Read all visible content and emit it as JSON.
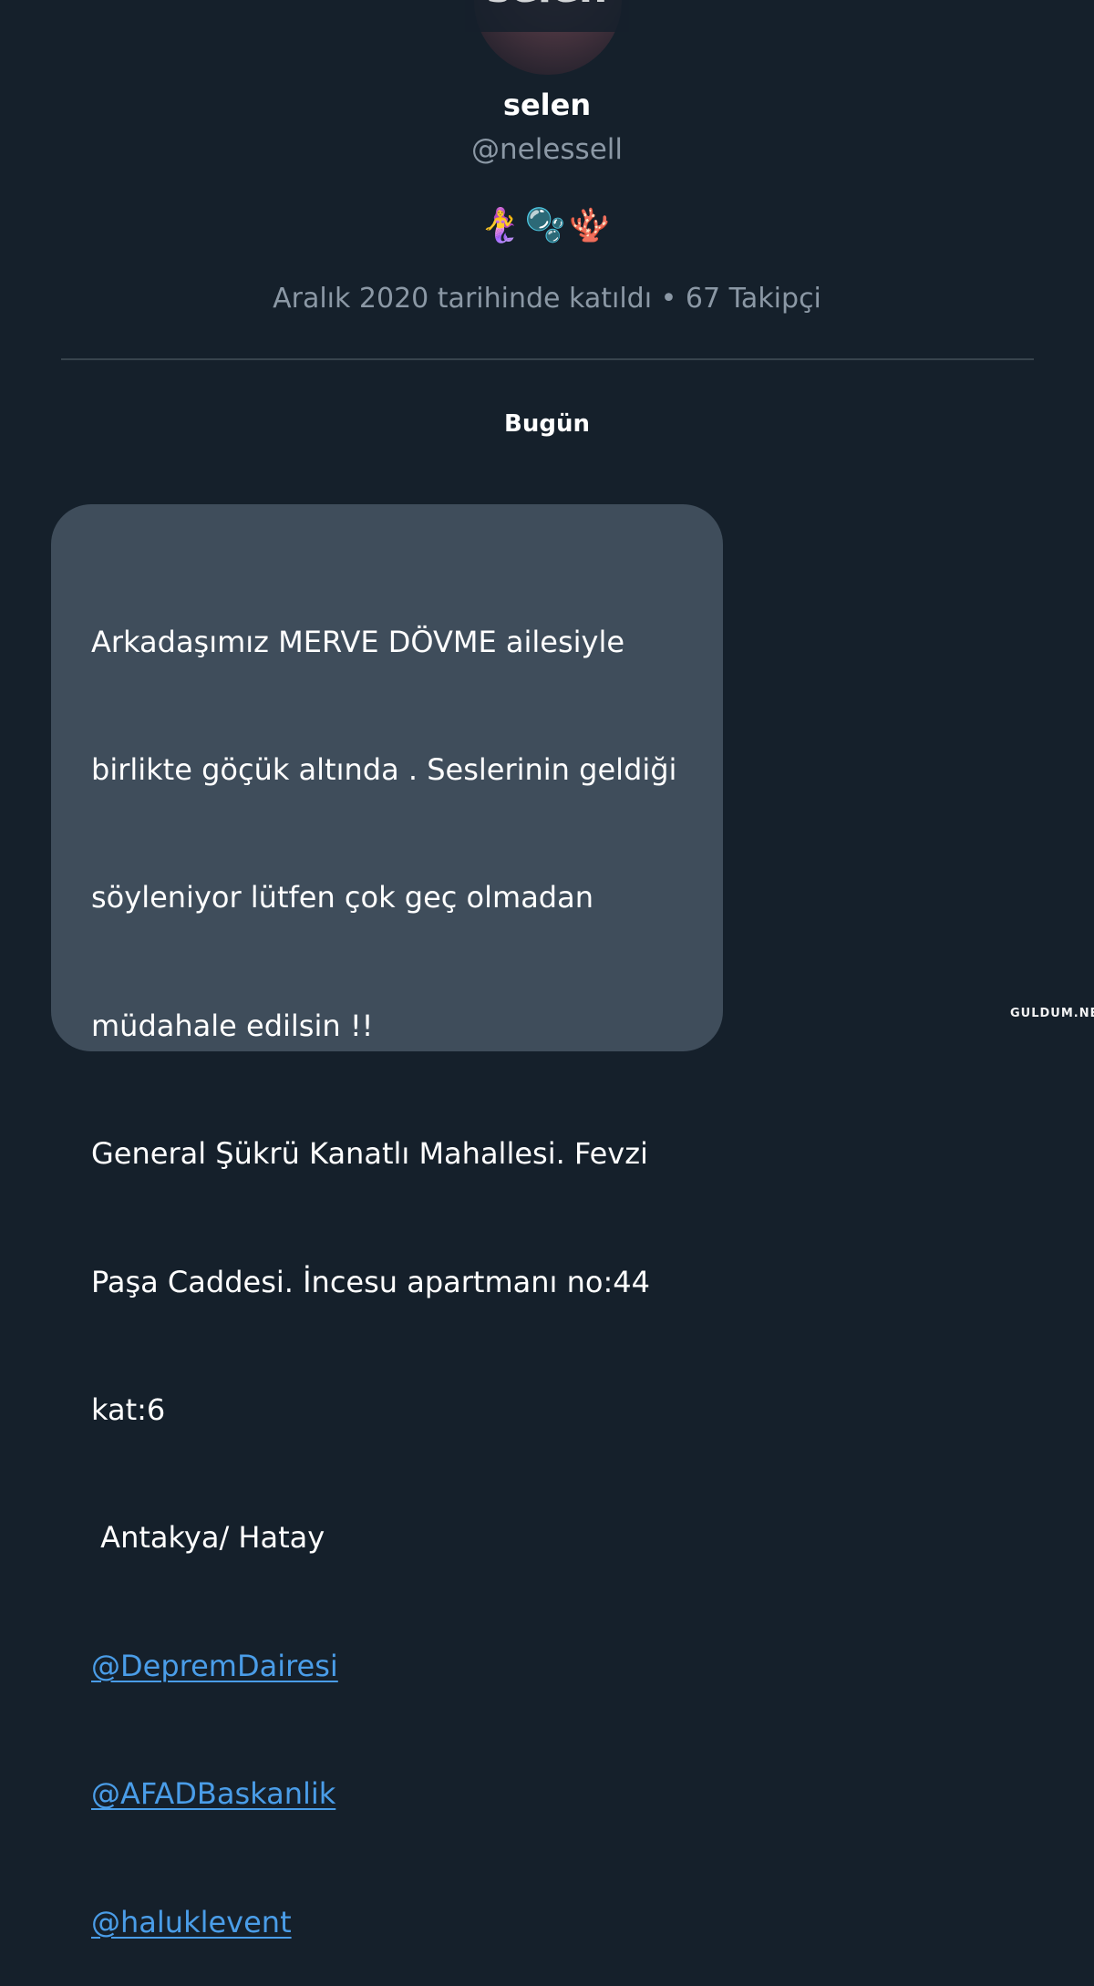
{
  "profile": {
    "top_name_partial": "selen",
    "display_name": "selen",
    "handle": "@nelessell",
    "bio_emojis": "🧜‍♀️🫧🪸",
    "joined": "Aralık 2020 tarihinde katıldı",
    "separator": "•",
    "followers": "67 Takipçi"
  },
  "conversation": {
    "day_label": "Bugün",
    "message": {
      "lines": [
        "Arkadaşımız MERVE DÖVME ailesiyle",
        "birlikte göçük altında . Seslerinin geldiği",
        "söyleniyor lütfen çok geç olmadan",
        "müdahale edilsin !!",
        "General Şükrü Kanatlı Mahallesi. Fevzi",
        "Paşa Caddesi. İncesu apartmanı no:44",
        "kat:6",
        " Antakya/ Hatay"
      ],
      "mentions": [
        "@DepremDairesi",
        "@AFADBaskanlik",
        "@haluklevent"
      ]
    }
  },
  "watermark": "GULDUM.NET",
  "colors": {
    "background": "#15202b",
    "bubble": "#3f4d5b",
    "link": "#4a9de8",
    "secondary_text": "#8b98a5"
  }
}
